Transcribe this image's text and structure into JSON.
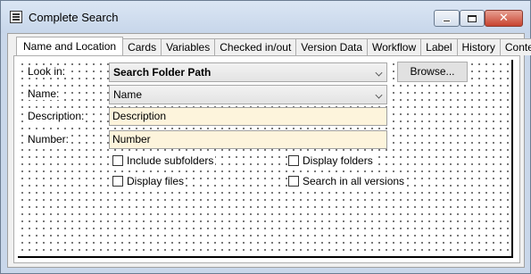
{
  "window": {
    "title": "Complete Search",
    "icon": "window-app-icon"
  },
  "caption": {
    "min_icon": "minimize-icon",
    "max_icon": "maximize-icon",
    "close_icon": "close-icon",
    "close_glyph": "✕"
  },
  "tabs": [
    {
      "label": "Name and Location",
      "active": true
    },
    {
      "label": "Cards"
    },
    {
      "label": "Variables"
    },
    {
      "label": "Checked in/out"
    },
    {
      "label": "Version Data"
    },
    {
      "label": "Workflow"
    },
    {
      "label": "Label"
    },
    {
      "label": "History"
    },
    {
      "label": "Content"
    }
  ],
  "form": {
    "look_in_label": "Look in:",
    "look_in_value": "Search Folder Path",
    "browse_label": "Browse...",
    "name_label": "Name:",
    "name_value": "Name",
    "description_label": "Description:",
    "description_value": "Description",
    "number_label": "Number:",
    "number_value": "Number",
    "include_subfolders": "Include subfolders",
    "display_folders": "Display folders",
    "display_files": "Display files",
    "search_all_versions": "Search in all versions"
  },
  "colors": {
    "field_bg": "#fdf4dc",
    "titlebar": "#c9d7ea",
    "close": "#c7432f"
  }
}
